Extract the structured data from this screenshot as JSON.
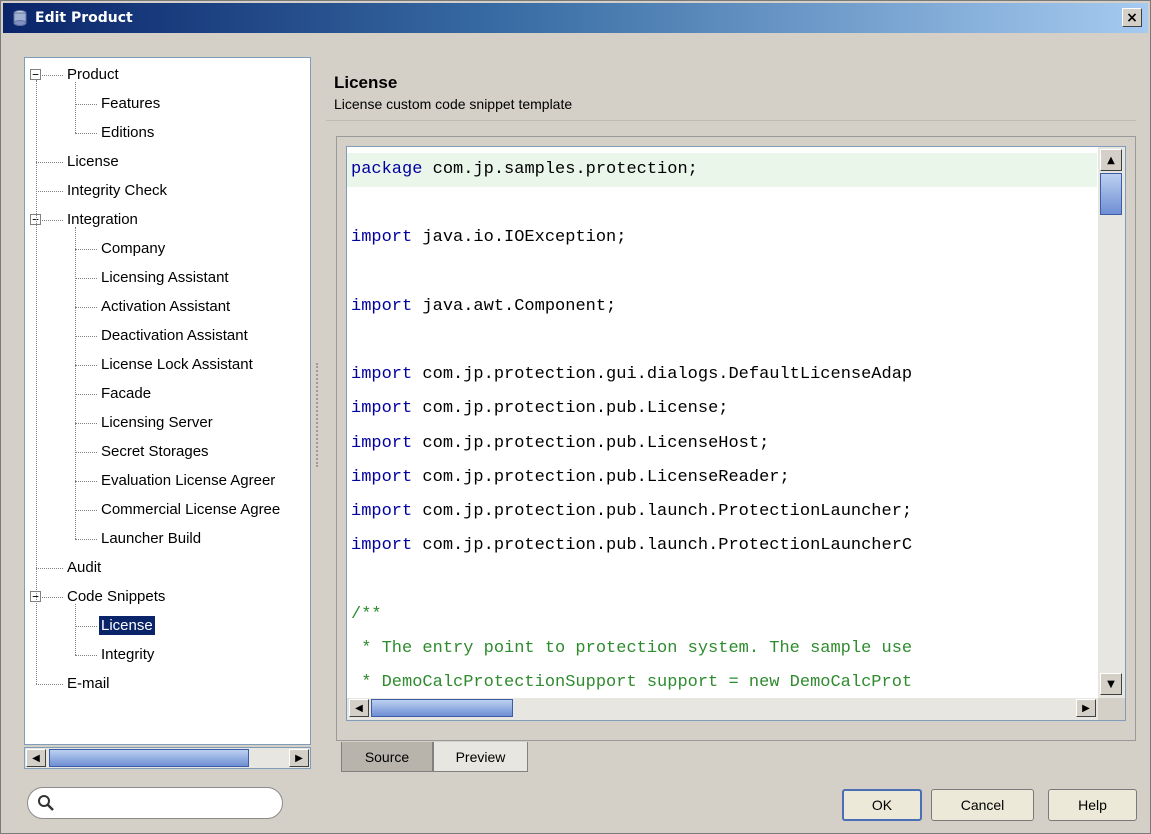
{
  "window": {
    "title": "Edit Product",
    "close_glyph": "×"
  },
  "tree": {
    "items": [
      {
        "label": "Product",
        "level": 0,
        "expander": "−"
      },
      {
        "label": "Features",
        "level": 1
      },
      {
        "label": "Editions",
        "level": 1
      },
      {
        "label": "License",
        "level": 0
      },
      {
        "label": "Integrity Check",
        "level": 0
      },
      {
        "label": "Integration",
        "level": 0,
        "expander": "−"
      },
      {
        "label": "Company",
        "level": 1
      },
      {
        "label": "Licensing Assistant",
        "level": 1
      },
      {
        "label": "Activation Assistant",
        "level": 1
      },
      {
        "label": "Deactivation Assistant",
        "level": 1
      },
      {
        "label": "License Lock Assistant",
        "level": 1
      },
      {
        "label": "Facade",
        "level": 1
      },
      {
        "label": "Licensing Server",
        "level": 1
      },
      {
        "label": "Secret Storages",
        "level": 1
      },
      {
        "label": "Evaluation License Agreer",
        "level": 1
      },
      {
        "label": "Commercial License Agree",
        "level": 1
      },
      {
        "label": "Launcher Build",
        "level": 1
      },
      {
        "label": "Audit",
        "level": 0
      },
      {
        "label": "Code Snippets",
        "level": 0,
        "expander": "−"
      },
      {
        "label": "License",
        "level": 1,
        "selected": true
      },
      {
        "label": "Integrity",
        "level": 1
      },
      {
        "label": "E-mail",
        "level": 0
      }
    ]
  },
  "search": {
    "value": "",
    "placeholder": ""
  },
  "header": {
    "title": "License",
    "subtitle": "License custom code snippet template"
  },
  "code": {
    "lines": [
      {
        "kw": "package",
        "rest": " com.jp.samples.protection;"
      },
      {
        "kw": "",
        "rest": ""
      },
      {
        "kw": "import",
        "rest": " java.io.IOException;"
      },
      {
        "kw": "",
        "rest": ""
      },
      {
        "kw": "import",
        "rest": " java.awt.Component;"
      },
      {
        "kw": "",
        "rest": ""
      },
      {
        "kw": "import",
        "rest": " com.jp.protection.gui.dialogs.DefaultLicenseAdap"
      },
      {
        "kw": "import",
        "rest": " com.jp.protection.pub.License;"
      },
      {
        "kw": "import",
        "rest": " com.jp.protection.pub.LicenseHost;"
      },
      {
        "kw": "import",
        "rest": " com.jp.protection.pub.LicenseReader;"
      },
      {
        "kw": "import",
        "rest": " com.jp.protection.pub.launch.ProtectionLauncher;"
      },
      {
        "kw": "import",
        "rest": " com.jp.protection.pub.launch.ProtectionLauncherC"
      },
      {
        "kw": "",
        "rest": ""
      },
      {
        "comment": "/**"
      },
      {
        "comment": " * The entry point to protection system. The sample use"
      },
      {
        "comment": " * DemoCalcProtectionSupport support = new DemoCalcProt"
      }
    ]
  },
  "tabs": [
    {
      "label": "Source",
      "active": true
    },
    {
      "label": "Preview",
      "active": false
    }
  ],
  "buttons": {
    "ok": "OK",
    "cancel": "Cancel",
    "help": "Help"
  },
  "scroll_arrows": {
    "up": "▲",
    "down": "▼",
    "left": "◀",
    "right": "▶"
  }
}
